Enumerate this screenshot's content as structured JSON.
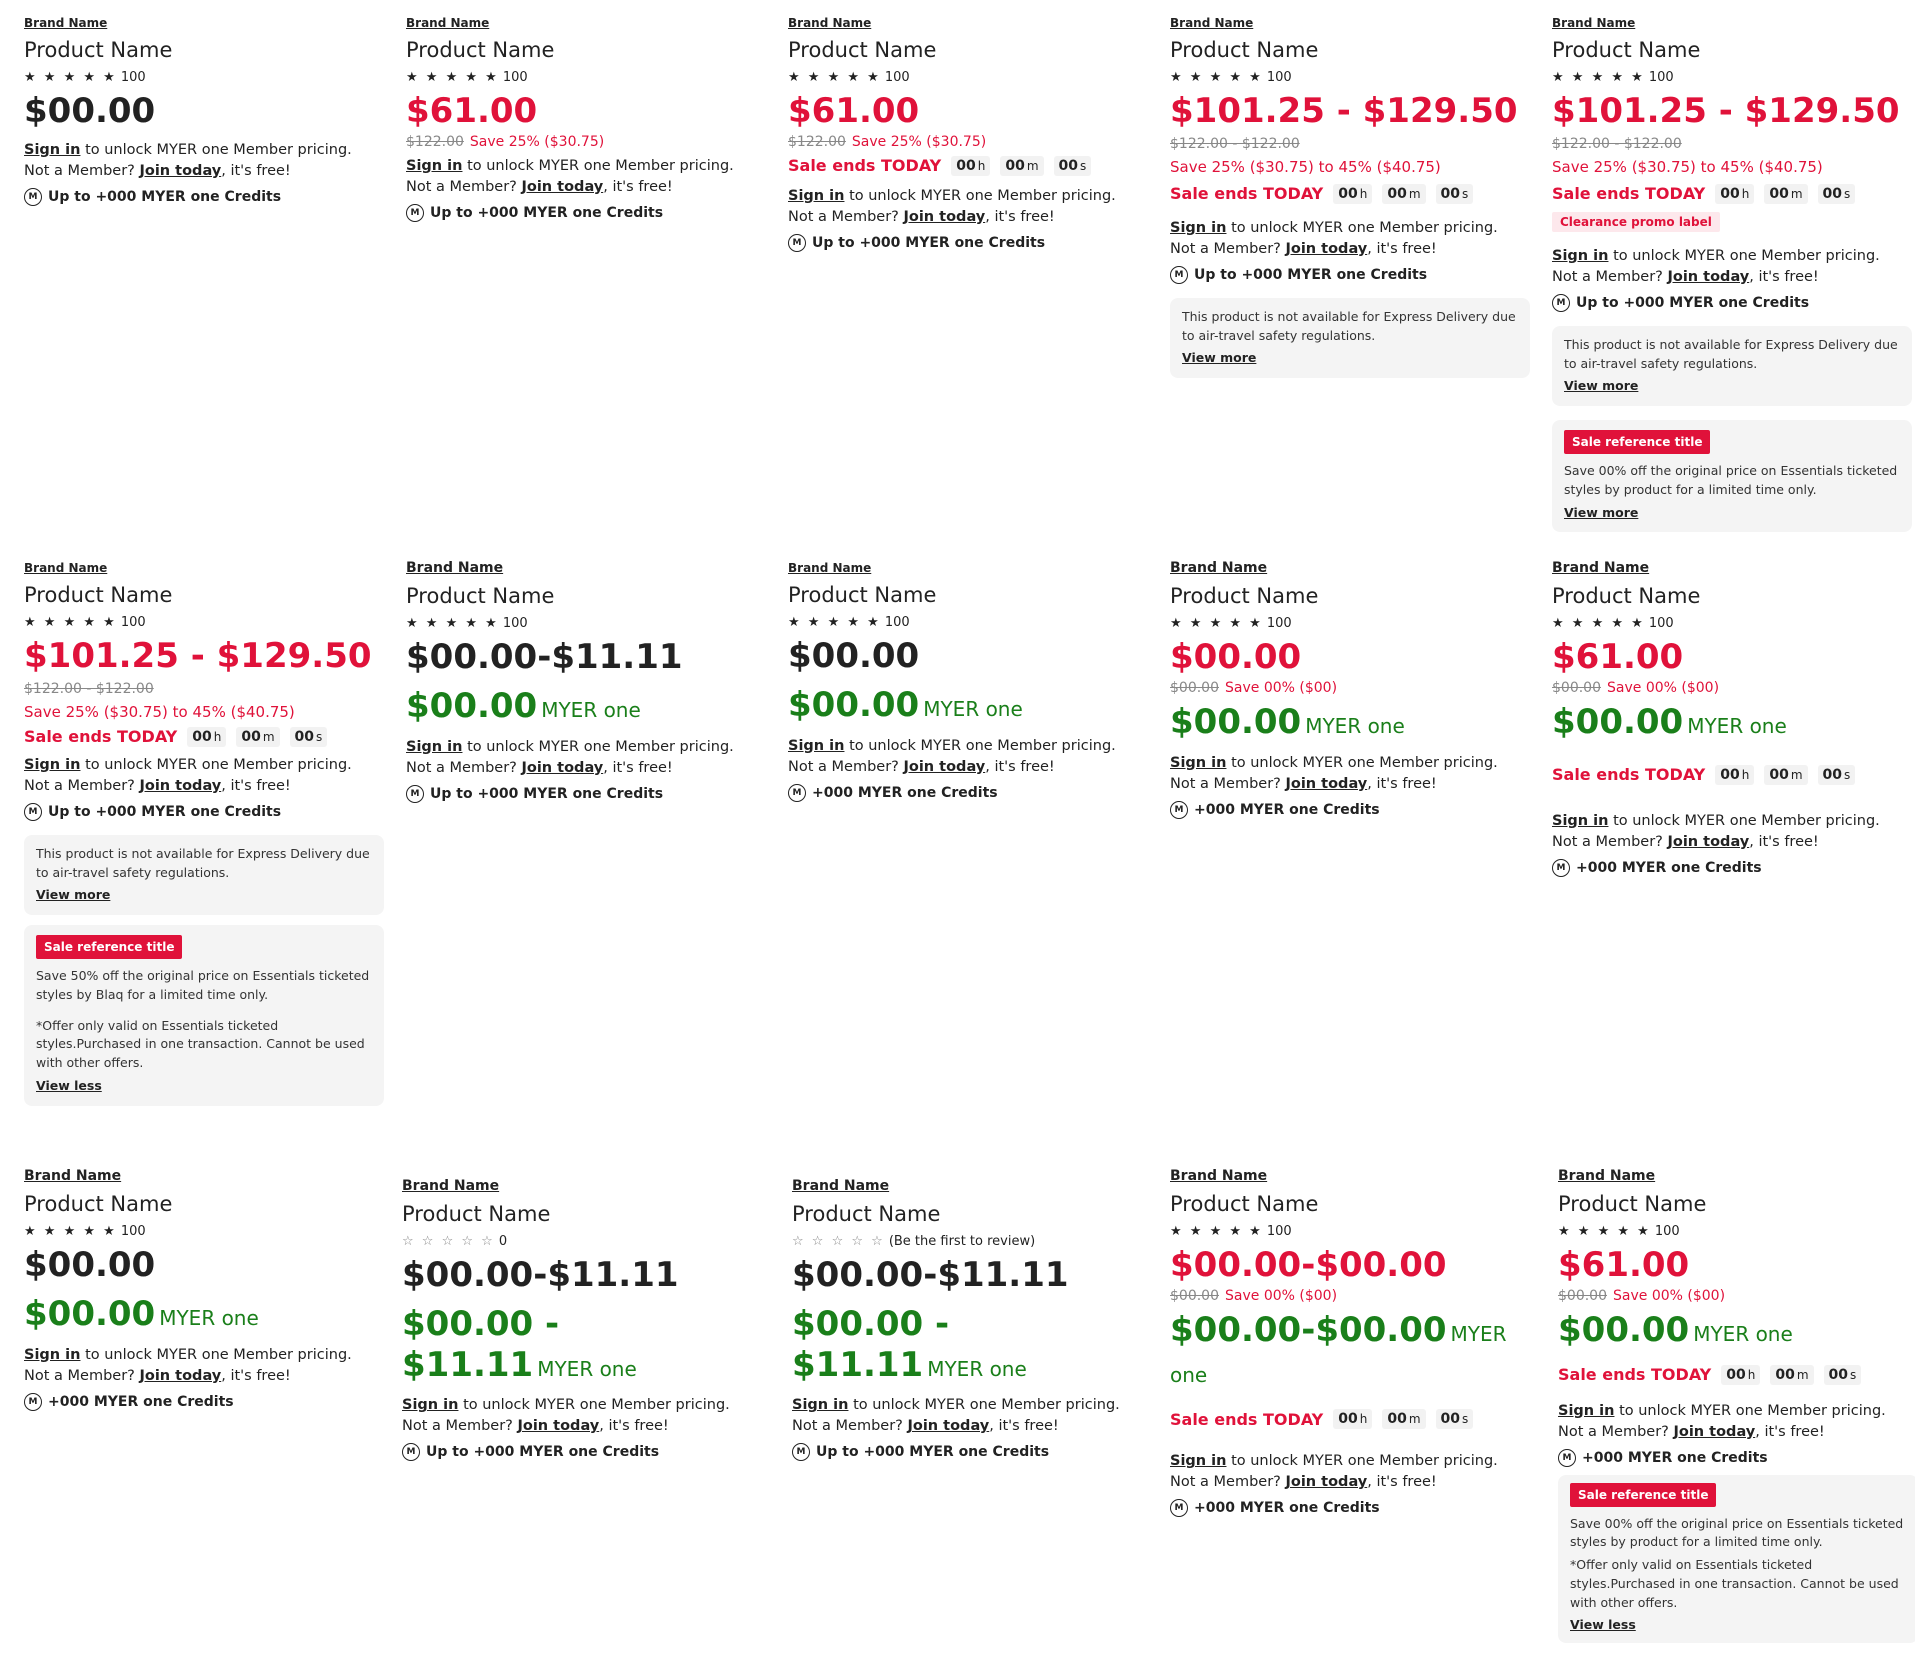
{
  "common": {
    "brand": "Brand Name",
    "product": "Product Name",
    "stars_full": "★ ★ ★ ★ ★",
    "stars_empty": "☆ ☆ ☆ ☆ ☆",
    "rating_count": "100",
    "rating_zero": "0",
    "rating_first": "(Be the first to review)",
    "sign_in": "Sign in",
    "sign_in_rest": " to unlock MYER one Member pricing.",
    "not_member": "Not a Member? ",
    "join_today": "Join today",
    "its_free": ", it's free!",
    "credits_up": "Up to +000 MYER one Credits",
    "credits": "+000 MYER one Credits",
    "myer_one": "MYER one",
    "sale_ends": "Sale ends TODAY",
    "timer_h": "00",
    "timer_m": "00",
    "timer_s": "00",
    "unit_h": "h",
    "unit_m": "m",
    "unit_s": "s",
    "m_icon": "M",
    "express_note": "This product is not available for Express Delivery due to air-travel safety regulations.",
    "view_more": "View more",
    "view_less": "View less",
    "sale_ref_title": "Sale reference title",
    "sale_ref_body": "Save 00% off the original price on Essentials ticketed styles by product for a limited time only.",
    "sale_ref_body_blaq": "Save 50% off the original price on Essentials ticketed styles by Blaq for a limited time only.",
    "offer_note": "*Offer only valid on Essentials ticketed styles.Purchased in one transaction. Cannot be used with other offers.",
    "clearance_label": "Clearance promo label"
  },
  "prices": {
    "p_zero": "$00.00",
    "p_61": "$61.00",
    "p_range": "$101.25 - $129.50",
    "p_range2": "$00.00-$11.11",
    "p_member_range": "$00.00 - $11.11",
    "p_zero_range": "$00.00-$00.00",
    "was_122": "$122.00",
    "was_122_range": "$122.00 - $122.00",
    "was_zero": "$00.00",
    "save_25": "Save 25% ($30.75)",
    "save_range": "Save 25% ($30.75) to 45% ($40.75)",
    "save_00": "Save 00% ($00)"
  },
  "colors": {
    "sale_red": "#e0123a",
    "member_green": "#1a7f1a"
  }
}
